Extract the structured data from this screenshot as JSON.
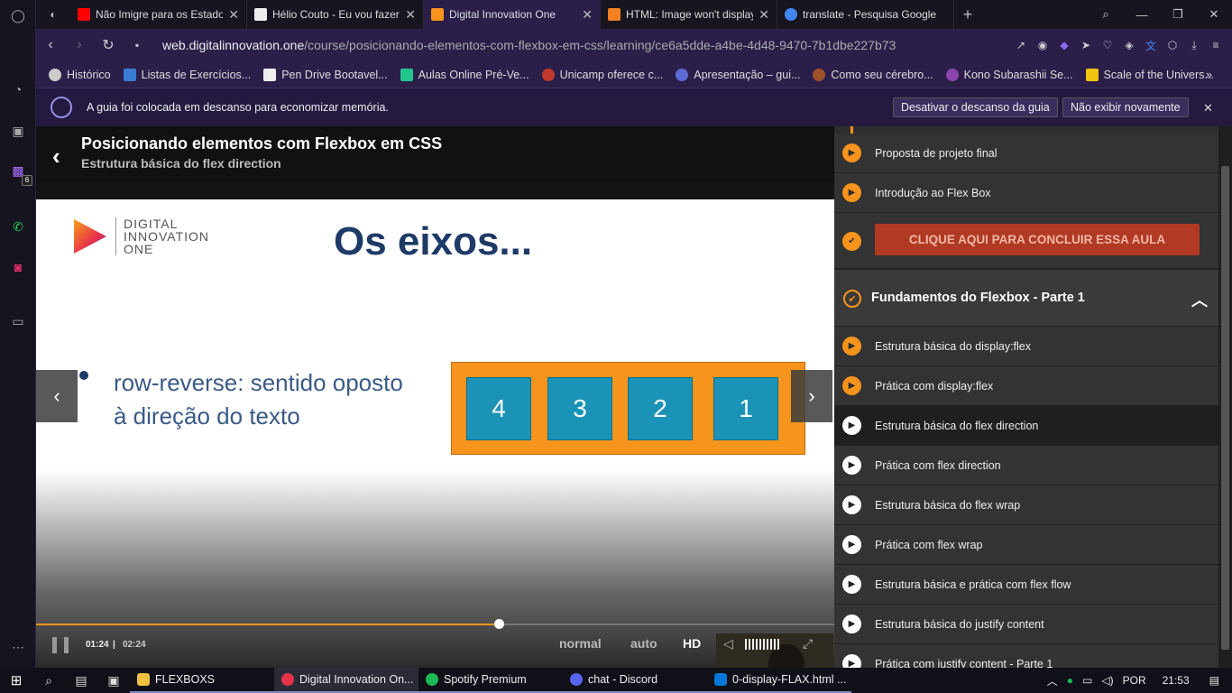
{
  "tabs": [
    {
      "title": "Não Imigre para os Estados",
      "fav_color": "#ff0000"
    },
    {
      "title": "Hélio Couto - Eu vou fazer",
      "fav_color": "#eeeeee"
    },
    {
      "title": "Digital Innovation One",
      "fav_color": "#f7941d"
    },
    {
      "title": "HTML: Image won't display",
      "fav_color": "#f48024"
    },
    {
      "title": "translate - Pesquisa Google",
      "fav_color": "#4285f4"
    }
  ],
  "address": {
    "host": "web.digitalinnovation.one",
    "path": "/course/posicionando-elementos-com-flexbox-em-css/learning/ce6a5dde-a4be-4d48-9470-7b1dbe227b73"
  },
  "bookmarks": [
    {
      "label": "Histórico",
      "color": "#cccccc"
    },
    {
      "label": "Listas de Exercícios...",
      "color": "#3a7bd5"
    },
    {
      "label": "Pen Drive Bootavel...",
      "color": "#eeeeee"
    },
    {
      "label": "Aulas Online Pré-Ve...",
      "color": "#23c48e"
    },
    {
      "label": "Unicamp oferece c...",
      "color": "#c0392b"
    },
    {
      "label": "Apresentação – gui...",
      "color": "#5d6bd5"
    },
    {
      "label": "Como seu cérebro...",
      "color": "#a0522d"
    },
    {
      "label": "Kono Subarashii Se...",
      "color": "#8e44ad"
    },
    {
      "label": "Scale of the Univers...",
      "color": "#f1c40f"
    }
  ],
  "notice": {
    "message": "A guia foi colocada em descanso para economizar memória.",
    "disable_label": "Desativar o descanso da guia",
    "dismiss_label": "Não exibir novamente"
  },
  "video": {
    "title": "Posicionando elementos com Flexbox em CSS",
    "subtitle": "Estrutura básica do flex direction",
    "slide": {
      "logo_lines": [
        "DIGITAL",
        "INNOVATION",
        "ONE"
      ],
      "heading": "Os eixos...",
      "bullet_line1": "row-reverse: sentido oposto",
      "bullet_line2": "à direção do texto",
      "items": [
        "4",
        "3",
        "2",
        "1"
      ]
    },
    "current_time": "01:24",
    "separator": "|",
    "duration": "02:24",
    "progress": 0.58,
    "speed_label": "normal",
    "quality_auto": "auto",
    "quality_hd": "HD"
  },
  "lessons_top": [
    {
      "label": "Proposta de projeto final",
      "state": "done"
    },
    {
      "label": "Introdução ao Flex Box",
      "state": "done"
    }
  ],
  "cta_label": "CLIQUE AQUI PARA CONCLUIR ESSA AULA",
  "section": {
    "title": "Fundamentos do Flexbox - Parte 1"
  },
  "lessons": [
    {
      "label": "Estrutura básica do display:flex",
      "state": "done"
    },
    {
      "label": "Prática com display:flex",
      "state": "done"
    },
    {
      "label": "Estrutura básica do flex direction",
      "state": "current"
    },
    {
      "label": "Prática com flex direction",
      "state": "todo"
    },
    {
      "label": "Estrutura básica do flex wrap",
      "state": "todo"
    },
    {
      "label": "Prática com flex wrap",
      "state": "todo"
    },
    {
      "label": "Estrutura básica e prática com flex flow",
      "state": "todo"
    },
    {
      "label": "Estrutura básica do justify content",
      "state": "todo"
    },
    {
      "label": "Prática com justify content - Parte 1",
      "state": "todo"
    }
  ],
  "sidebar_badge": "6",
  "taskbar": {
    "apps": [
      {
        "label": "FLEXBOXS",
        "color": "#f0c040"
      },
      {
        "label": "Digital Innovation On...",
        "color": "#e8314b"
      },
      {
        "label": "Spotify Premium",
        "color": "#1db954"
      },
      {
        "label": "chat - Discord",
        "color": "#5865f2"
      },
      {
        "label": "0-display-FLAX.html ...",
        "color": "#0078d7"
      }
    ],
    "lang": "POR",
    "clock": "21:53"
  }
}
